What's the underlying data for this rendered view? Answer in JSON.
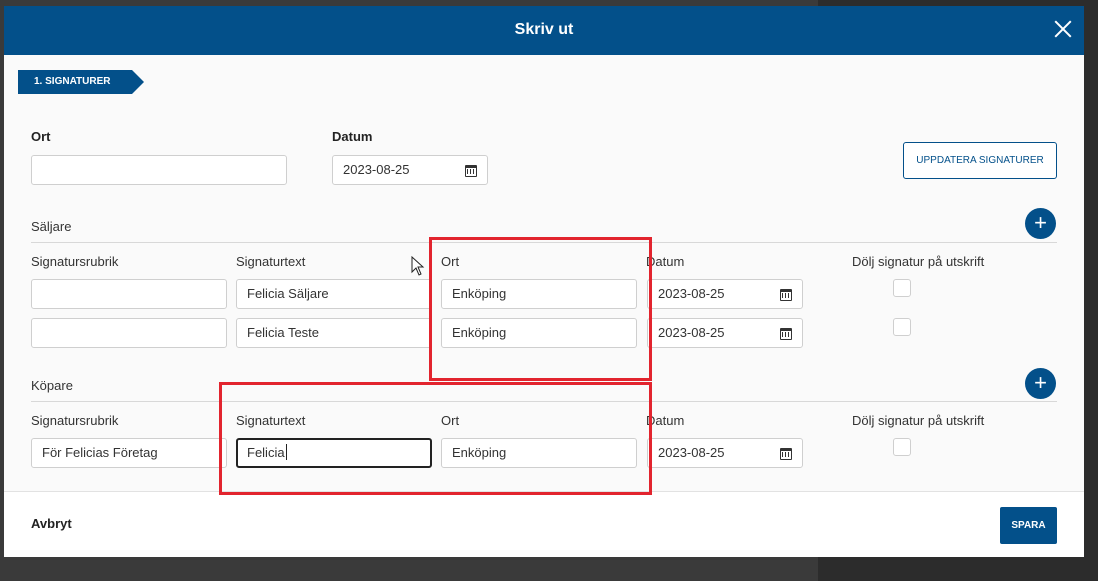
{
  "dialog": {
    "title": "Skriv ut"
  },
  "step": {
    "label": "1. SIGNATURER"
  },
  "top": {
    "ort_label": "Ort",
    "ort_value": "",
    "datum_label": "Datum",
    "datum_value": "2023-08-25",
    "update_button": "UPPDATERA SIGNATURER"
  },
  "columns": {
    "rubrik": "Signatursrubrik",
    "text": "Signaturtext",
    "ort": "Ort",
    "datum": "Datum",
    "hide": "Dölj signatur på utskrift"
  },
  "saljare": {
    "title": "Säljare",
    "rows": [
      {
        "rubrik": "",
        "text": "Felicia Säljare",
        "ort": "Enköping",
        "datum": "2023-08-25"
      },
      {
        "rubrik": "",
        "text": "Felicia Teste",
        "ort": "Enköping",
        "datum": "2023-08-25"
      }
    ]
  },
  "kopare": {
    "title": "Köpare",
    "rows": [
      {
        "rubrik": "För  Felicias Företag",
        "text": "Felicia",
        "ort": "Enköping",
        "datum": "2023-08-25"
      }
    ]
  },
  "footer": {
    "cancel": "Avbryt",
    "save": "SPARA"
  },
  "colors": {
    "primary": "#03508a",
    "highlight": "#e2242e"
  },
  "icons": {
    "close": "close-icon",
    "add": "plus-icon",
    "calendar": "calendar-icon",
    "pointer": "mouse-cursor-icon"
  }
}
